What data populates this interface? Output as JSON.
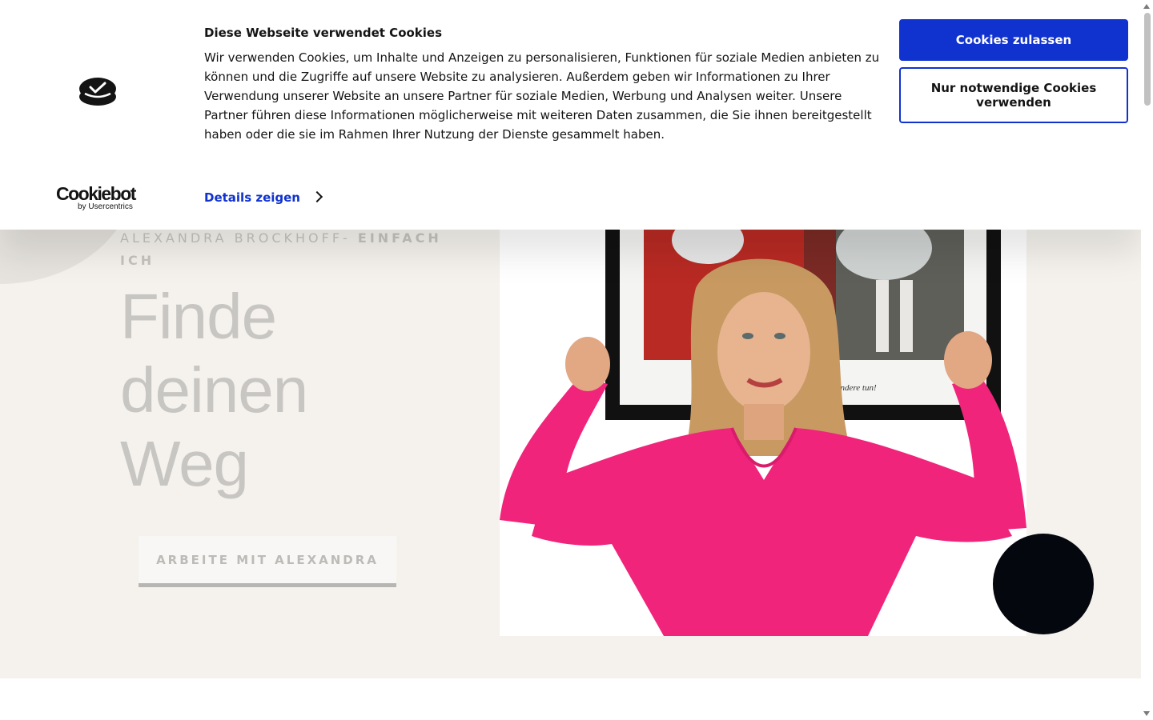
{
  "cookie_banner": {
    "title": "Diese Webseite verwendet Cookies",
    "text": "Wir verwenden Cookies, um Inhalte und Anzeigen zu personalisieren, Funktionen für soziale Medien anbieten zu können und die Zugriffe auf unsere Website zu analysieren. Außerdem geben wir Informationen zu Ihrer Verwendung unserer Website an unsere Partner für soziale Medien, Werbung und Analysen weiter. Unsere Partner führen diese Informationen möglicherweise mit weiteren Daten zusammen, die Sie ihnen bereitgestellt haben oder die sie im Rahmen Ihrer Nutzung der Dienste gesammelt haben.",
    "details_label": "Details zeigen",
    "allow_label": "Cookies zulassen",
    "necessary_label": "Nur notwendige Cookies verwenden",
    "brand_name": "Cookiebot",
    "brand_by": "by Usercentrics",
    "logo_icon": "cookiebot-logo-icon",
    "accent_color": "#1032cf"
  },
  "hero": {
    "kicker_prefix": "ALEXANDRA BROCKHOFF- ",
    "kicker_strong": "EINFACH ICH",
    "headline_lines": [
      "Finde",
      "deinen",
      "Weg"
    ],
    "cta_label": "ARBEITE MIT ALEXANDRA",
    "photo_caption": "andere tun!",
    "background_color": "#f5f2ed",
    "shirt_color": "#f0247a"
  }
}
